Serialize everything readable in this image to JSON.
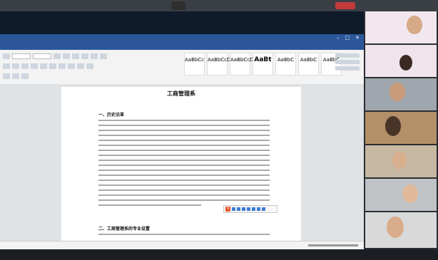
{
  "meeting": {
    "title": "",
    "remote_name": "",
    "self_name": ""
  },
  "word": {
    "title": "",
    "tabs": [
      "",
      "",
      "",
      "",
      "",
      "",
      "",
      "",
      "",
      "",
      ""
    ],
    "active_tab": 1,
    "styles": [
      {
        "preview": "AaBbCc",
        "name": ""
      },
      {
        "preview": "AaBbCcD",
        "name": ""
      },
      {
        "preview": "AaBbCcDc",
        "name": ""
      },
      {
        "preview": "AaBt",
        "name": ""
      },
      {
        "preview": "AaBbC",
        "name": ""
      },
      {
        "preview": "AaBbC",
        "name": ""
      },
      {
        "preview": "AaBbC",
        "name": ""
      }
    ]
  },
  "document": {
    "title": "工商管理系",
    "section1_heading": "一、历史沿革",
    "section2_heading": "二、工商管理系的专业设置"
  },
  "participants": [
    {
      "label": "",
      "banner": "",
      "banner2": ""
    },
    {
      "label": "",
      "banner": "",
      "banner2": ""
    },
    {
      "label": ""
    },
    {
      "label": ""
    },
    {
      "label": ""
    },
    {
      "label": ""
    },
    {
      "label": ""
    }
  ],
  "colors": {
    "word_blue": "#2b579a",
    "accent_red": "#c23a3a",
    "banner_pink": "#e43b6b"
  }
}
